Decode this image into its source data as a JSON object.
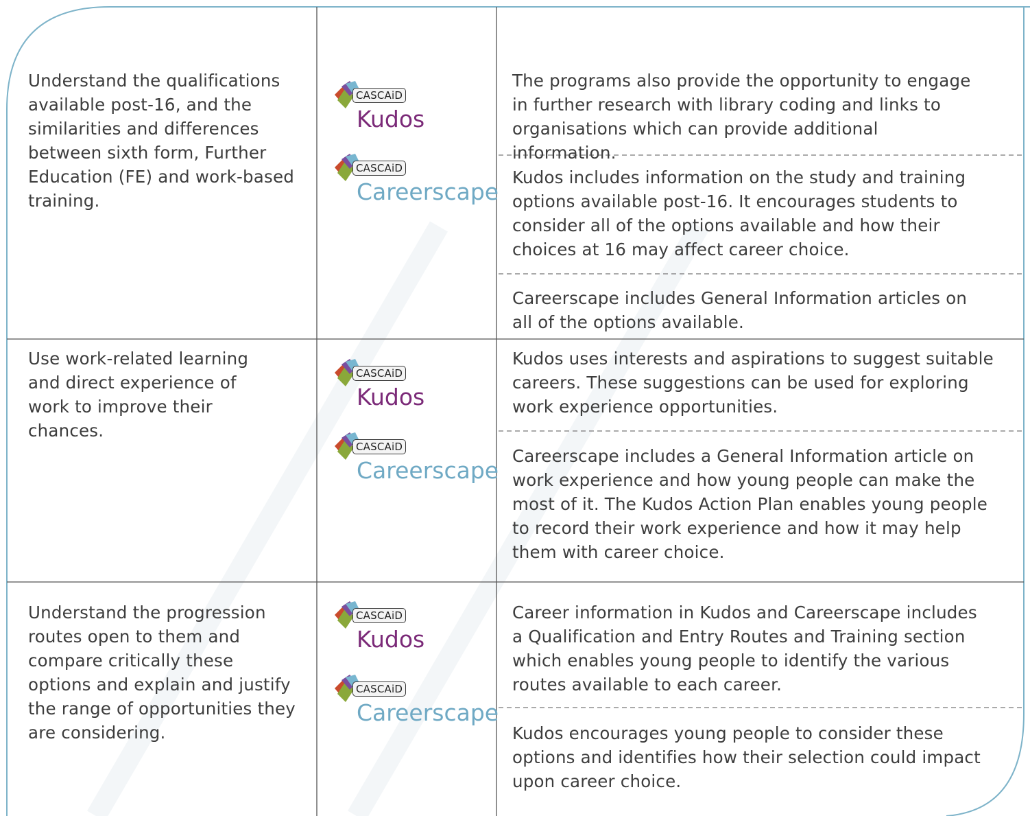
{
  "colors": {
    "frame": "#7db3c9",
    "grid": "#555555",
    "dash": "#777777",
    "kudos": "#7b2a78",
    "careerscape": "#6fa9c4",
    "text": "#3d3d3d"
  },
  "logos": {
    "badge_text": "CASCAiD",
    "kudos_name": "Kudos",
    "careerscape_name": "Careerscape"
  },
  "rows": [
    {
      "outcome": "Understand the qualifications available post-16, and the similarities and differences between sixth form, Further Education (FE) and work-based training.",
      "details": [
        "The programs also provide the opportunity to engage in further research with library coding and links to organisations which can provide additional information.",
        "Kudos includes information on the study and training options available post-16. It encourages students to consider all of the options available and how their choices at 16 may affect career choice.",
        "Careerscape includes General Information articles on all of the options available."
      ]
    },
    {
      "outcome": "Use work-related learning and direct experience of work to improve their chances.",
      "details": [
        "Kudos uses interests and aspirations to suggest suitable careers. These suggestions can be used for exploring work experience opportunities.",
        "Careerscape includes a General Information article on work experience and how young people can make the most of it. The Kudos Action Plan enables young people to record their work experience and how it may help them with career choice."
      ]
    },
    {
      "outcome": "Understand the progression routes open to them and compare critically these options and explain and justify the range of opportunities they are considering.",
      "details": [
        "Career information in Kudos and Careerscape includes a Qualification and Entry Routes and Training section which enables young people to identify the various routes available to each career.",
        "Kudos encourages young people to consider these options and identifies how their selection could impact upon career choice."
      ]
    }
  ]
}
